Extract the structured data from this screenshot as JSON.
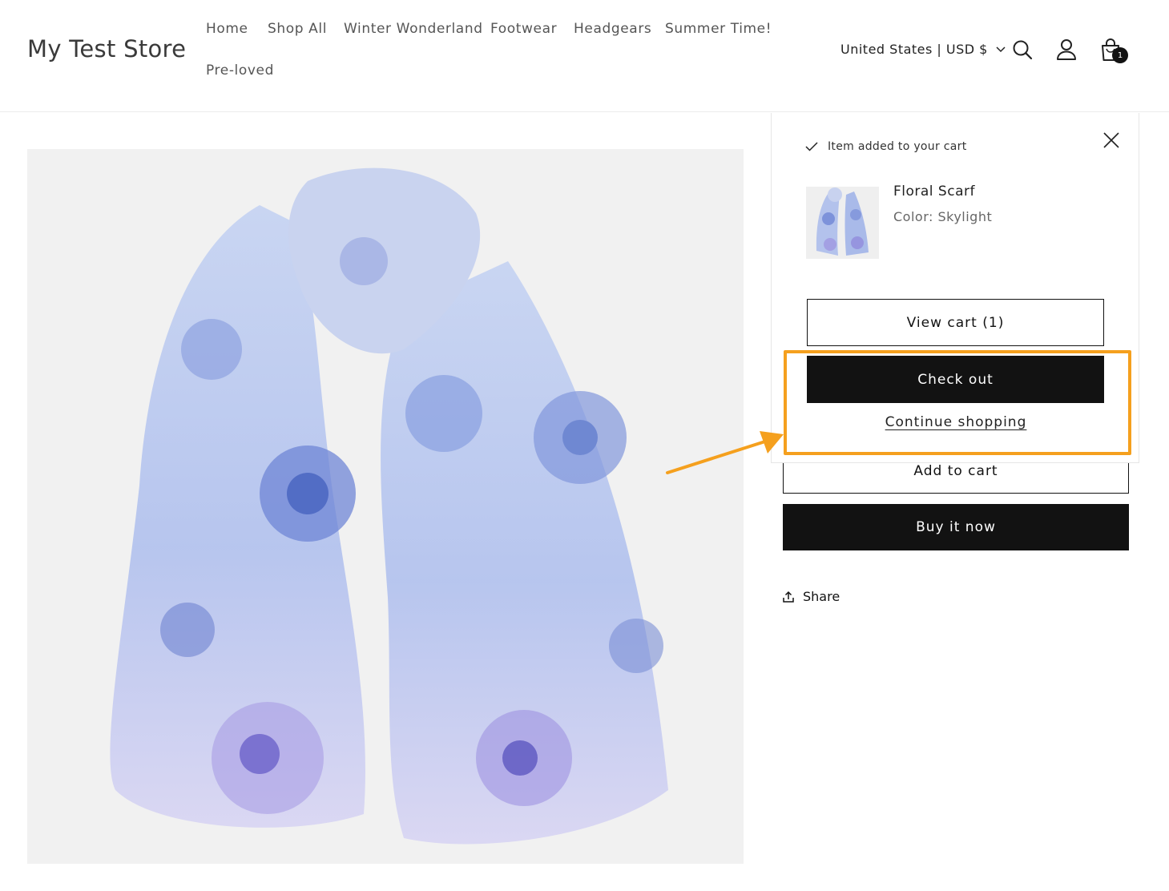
{
  "header": {
    "logo": "My Test Store",
    "nav": [
      {
        "label": "Home"
      },
      {
        "label": "Shop All"
      },
      {
        "label": "Winter Wonderland"
      },
      {
        "label": "Footwear"
      },
      {
        "label": "Headgears"
      },
      {
        "label": "Summer Time!"
      },
      {
        "label": "Pre-loved"
      }
    ],
    "locale": "United States | USD $",
    "cart_count": "1",
    "icons": [
      "search-icon",
      "account-icon",
      "cart-icon"
    ]
  },
  "product": {
    "add_to_cart": "Add to cart",
    "buy_now": "Buy it now",
    "share": "Share"
  },
  "cart_popup": {
    "status": "Item added to your cart",
    "item_name": "Floral Scarf",
    "item_variant": "Color: Skylight",
    "view_cart": "View cart (1)",
    "checkout": "Check out",
    "continue": "Continue shopping"
  },
  "colors": {
    "primary": "#121212",
    "annotation": "#f5a01e"
  }
}
